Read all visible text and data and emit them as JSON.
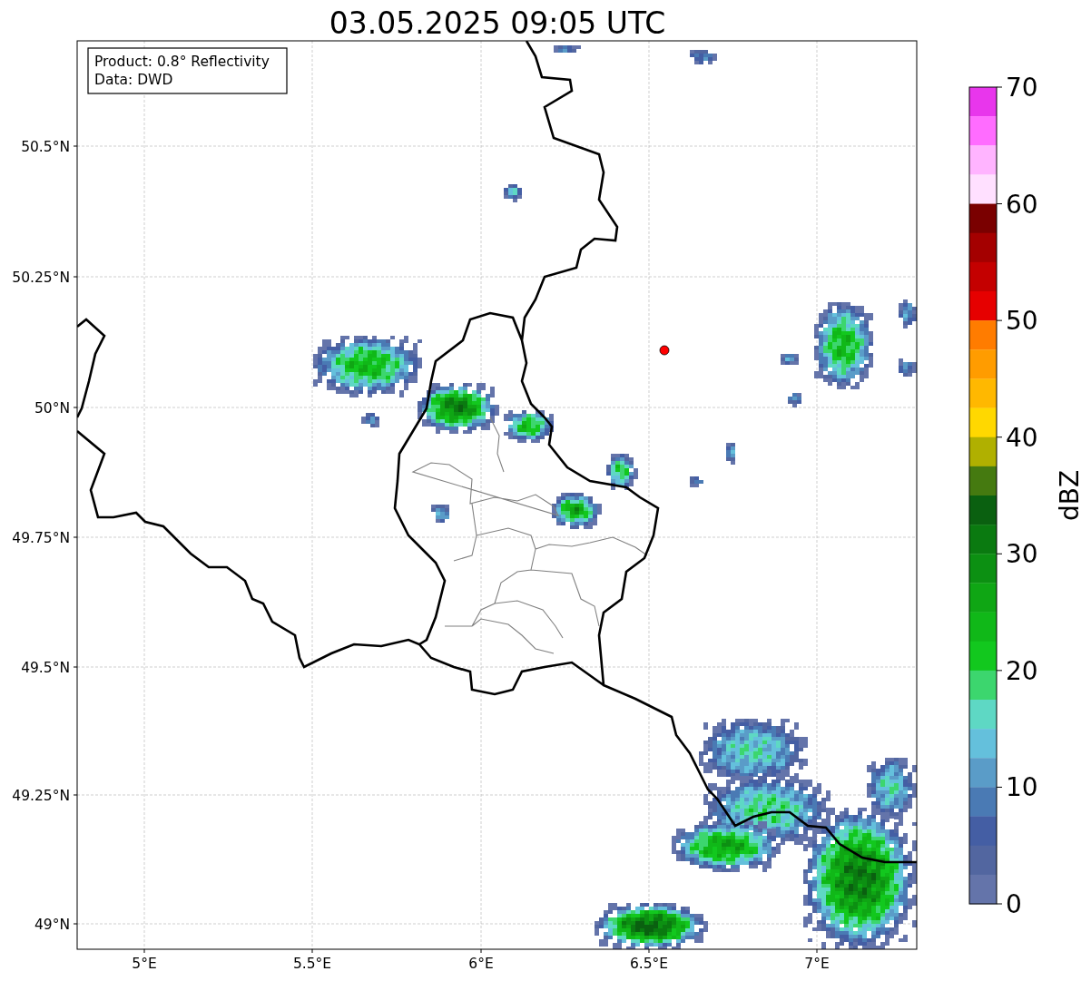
{
  "title": "03.05.2025 09:05 UTC",
  "annotation": [
    "Product: 0.8° Reflectivity",
    "Data: DWD"
  ],
  "lat_labels": [
    "50.5°N",
    "50.25°N",
    "50°N",
    "49.75°N",
    "49.5°N",
    "49.25°N",
    "49°N"
  ],
  "lon_labels": [
    "5°E",
    "5.5°E",
    "6°E",
    "6.5°E",
    "7°E"
  ],
  "colorbar": {
    "label": "dBZ",
    "ticks": [
      "70",
      "60",
      "50",
      "40",
      "30",
      "20",
      "10",
      "0"
    ],
    "bins": [
      {
        "color": "#e836ec"
      },
      {
        "color": "#ff6cff"
      },
      {
        "color": "#ffb4ff"
      },
      {
        "color": "#ffe0ff"
      },
      {
        "color": "#7a0000"
      },
      {
        "color": "#a40000"
      },
      {
        "color": "#c40000"
      },
      {
        "color": "#e60000"
      },
      {
        "color": "#ff7c00"
      },
      {
        "color": "#ff9c00"
      },
      {
        "color": "#ffb800"
      },
      {
        "color": "#ffd800"
      },
      {
        "color": "#b0b000"
      },
      {
        "color": "#457a10"
      },
      {
        "color": "#0a6010"
      },
      {
        "color": "#0a7a10"
      },
      {
        "color": "#0c9012"
      },
      {
        "color": "#0fa614"
      },
      {
        "color": "#10b818"
      },
      {
        "color": "#12c81e"
      },
      {
        "color": "#3cd66e"
      },
      {
        "color": "#5ed8c4"
      },
      {
        "color": "#64c0dc"
      },
      {
        "color": "#5a9cc8"
      },
      {
        "color": "#4a7ab4"
      },
      {
        "color": "#445ea4"
      },
      {
        "color": "#5266a0"
      },
      {
        "color": "#6474aa"
      }
    ]
  }
}
